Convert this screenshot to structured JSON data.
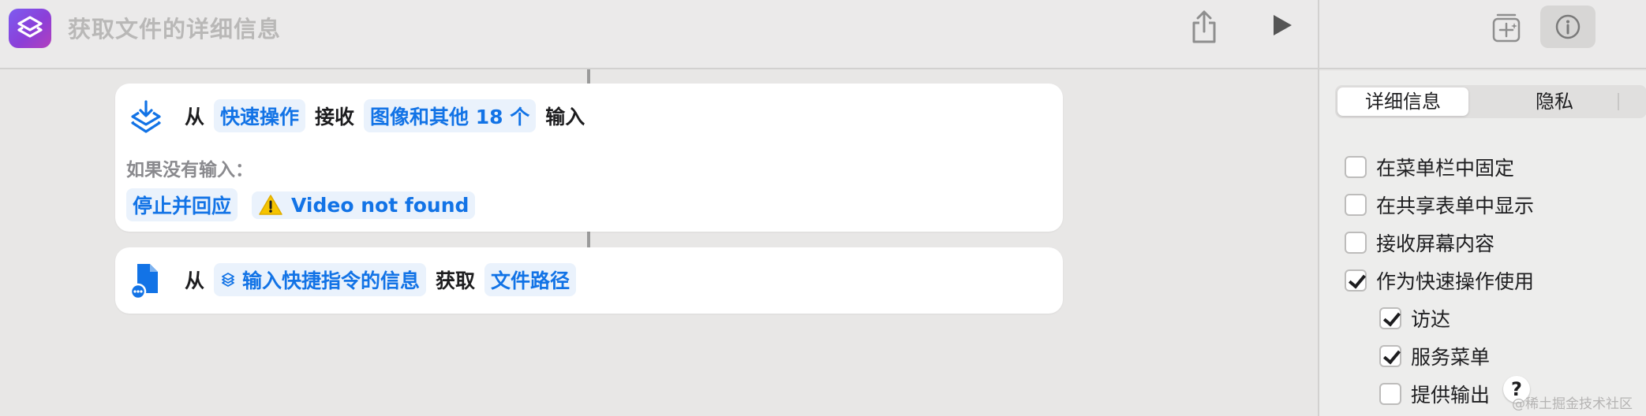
{
  "window": {
    "title": "获取文件的详细信息"
  },
  "workflow": {
    "receive_action": {
      "from_text": "从",
      "source_token": "快速操作",
      "receive_text": "接收",
      "types_token": "图像和其他 18 个",
      "input_text": "输入",
      "no_input_label": "如果没有输入：",
      "stop_token": "停止并回应",
      "response_token": "Video not found"
    },
    "get_details_action": {
      "from_text": "从",
      "source_token": "输入快捷指令的信息",
      "get_text": "获取",
      "detail_token": "文件路径"
    }
  },
  "sidebar": {
    "tabs": [
      {
        "label": "详细信息",
        "active": true
      },
      {
        "label": "隐私",
        "active": false
      }
    ],
    "options": [
      {
        "label": "在菜单栏中固定",
        "checked": false
      },
      {
        "label": "在共享表单中显示",
        "checked": false
      },
      {
        "label": "接收屏幕内容",
        "checked": false
      },
      {
        "label": "作为快速操作使用",
        "checked": true
      },
      {
        "label": "访达",
        "checked": true
      },
      {
        "label": "服务菜单",
        "checked": true
      },
      {
        "label": "提供输出",
        "checked": false
      }
    ],
    "help_label": "?"
  },
  "watermark": "@稀土掘金技术社区",
  "colors": {
    "accent_blue": "#1273e6",
    "token_bg": "#eaf2fc",
    "warning_yellow": "#f5c400"
  }
}
